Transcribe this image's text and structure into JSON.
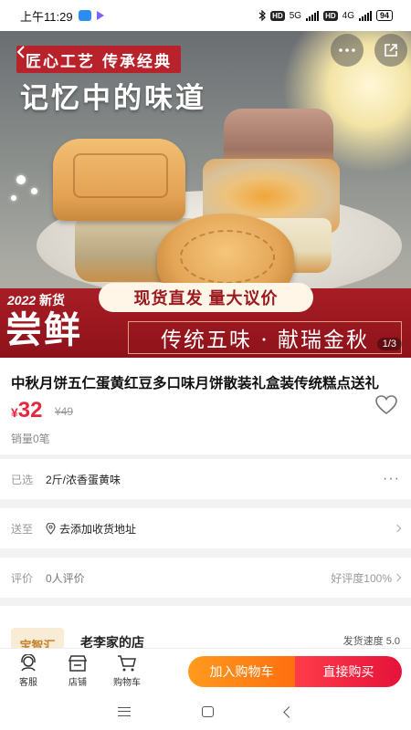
{
  "status_bar": {
    "time": "上午11:29",
    "net1": "5G",
    "net2": "4G",
    "hd": "HD",
    "battery": "94"
  },
  "hero": {
    "tag": "匠心工艺 传承经典",
    "headline": "记忆中的味道",
    "year_label": "2022",
    "year_suffix": "新货",
    "big_text": "尝鲜",
    "pill_text": "现货直发  量大议价",
    "slogan": "传统五味 · 献瑞金秋",
    "page_indicator": "1/3"
  },
  "product": {
    "title": "中秋月饼五仁蛋黄红豆多口味月饼散装礼盒装传统糕点送礼",
    "currency": "¥",
    "price": "32",
    "original_price": "¥49",
    "sales": "销量0笔"
  },
  "spec": {
    "label": "已选",
    "value": "2斤/浓香蛋黄味",
    "more": "···"
  },
  "address": {
    "label": "送至",
    "value": "去添加收货地址"
  },
  "review": {
    "label": "评价",
    "value": "0人评价",
    "rating": "好评度100%"
  },
  "shop": {
    "logo_text": "宝智汇",
    "name": "老李家的店",
    "ship_speed": "发货速度 5.0"
  },
  "actions": {
    "service": "客服",
    "store": "店铺",
    "cart": "购物车",
    "add_to_cart": "加入购物车",
    "buy_now": "直接购买"
  },
  "colors": {
    "accent": "#e8263f",
    "cart_btn": "#ff7f14",
    "buy_btn": "#ee1c3e",
    "banner_red": "#a81d25"
  }
}
